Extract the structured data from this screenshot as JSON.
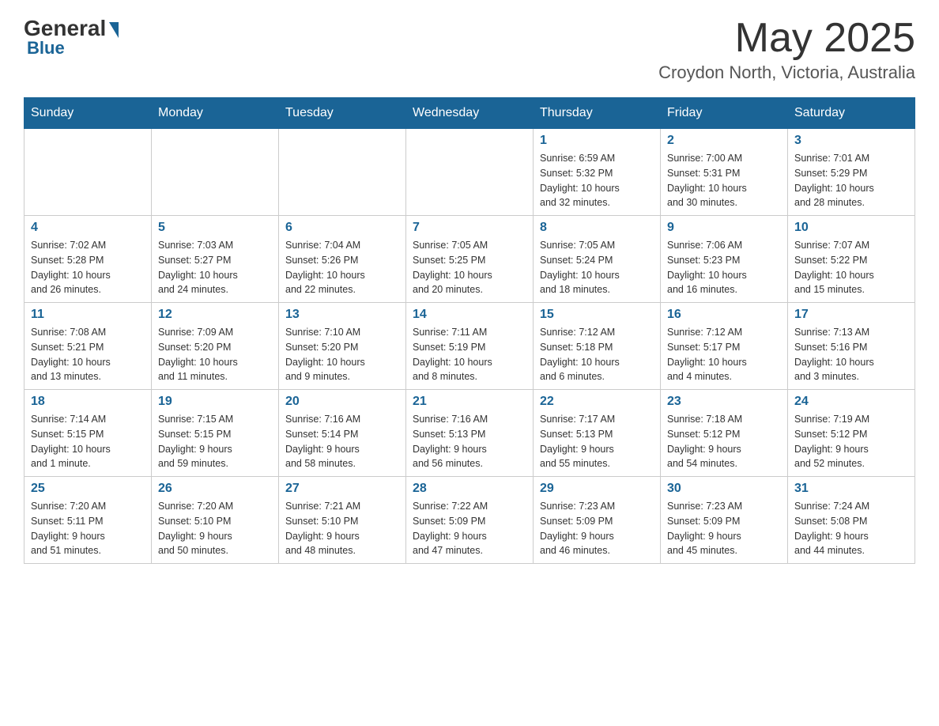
{
  "header": {
    "logo_general": "General",
    "logo_blue": "Blue",
    "month": "May 2025",
    "location": "Croydon North, Victoria, Australia"
  },
  "days_of_week": [
    "Sunday",
    "Monday",
    "Tuesday",
    "Wednesday",
    "Thursday",
    "Friday",
    "Saturday"
  ],
  "weeks": [
    [
      {
        "day": "",
        "info": ""
      },
      {
        "day": "",
        "info": ""
      },
      {
        "day": "",
        "info": ""
      },
      {
        "day": "",
        "info": ""
      },
      {
        "day": "1",
        "info": "Sunrise: 6:59 AM\nSunset: 5:32 PM\nDaylight: 10 hours\nand 32 minutes."
      },
      {
        "day": "2",
        "info": "Sunrise: 7:00 AM\nSunset: 5:31 PM\nDaylight: 10 hours\nand 30 minutes."
      },
      {
        "day": "3",
        "info": "Sunrise: 7:01 AM\nSunset: 5:29 PM\nDaylight: 10 hours\nand 28 minutes."
      }
    ],
    [
      {
        "day": "4",
        "info": "Sunrise: 7:02 AM\nSunset: 5:28 PM\nDaylight: 10 hours\nand 26 minutes."
      },
      {
        "day": "5",
        "info": "Sunrise: 7:03 AM\nSunset: 5:27 PM\nDaylight: 10 hours\nand 24 minutes."
      },
      {
        "day": "6",
        "info": "Sunrise: 7:04 AM\nSunset: 5:26 PM\nDaylight: 10 hours\nand 22 minutes."
      },
      {
        "day": "7",
        "info": "Sunrise: 7:05 AM\nSunset: 5:25 PM\nDaylight: 10 hours\nand 20 minutes."
      },
      {
        "day": "8",
        "info": "Sunrise: 7:05 AM\nSunset: 5:24 PM\nDaylight: 10 hours\nand 18 minutes."
      },
      {
        "day": "9",
        "info": "Sunrise: 7:06 AM\nSunset: 5:23 PM\nDaylight: 10 hours\nand 16 minutes."
      },
      {
        "day": "10",
        "info": "Sunrise: 7:07 AM\nSunset: 5:22 PM\nDaylight: 10 hours\nand 15 minutes."
      }
    ],
    [
      {
        "day": "11",
        "info": "Sunrise: 7:08 AM\nSunset: 5:21 PM\nDaylight: 10 hours\nand 13 minutes."
      },
      {
        "day": "12",
        "info": "Sunrise: 7:09 AM\nSunset: 5:20 PM\nDaylight: 10 hours\nand 11 minutes."
      },
      {
        "day": "13",
        "info": "Sunrise: 7:10 AM\nSunset: 5:20 PM\nDaylight: 10 hours\nand 9 minutes."
      },
      {
        "day": "14",
        "info": "Sunrise: 7:11 AM\nSunset: 5:19 PM\nDaylight: 10 hours\nand 8 minutes."
      },
      {
        "day": "15",
        "info": "Sunrise: 7:12 AM\nSunset: 5:18 PM\nDaylight: 10 hours\nand 6 minutes."
      },
      {
        "day": "16",
        "info": "Sunrise: 7:12 AM\nSunset: 5:17 PM\nDaylight: 10 hours\nand 4 minutes."
      },
      {
        "day": "17",
        "info": "Sunrise: 7:13 AM\nSunset: 5:16 PM\nDaylight: 10 hours\nand 3 minutes."
      }
    ],
    [
      {
        "day": "18",
        "info": "Sunrise: 7:14 AM\nSunset: 5:15 PM\nDaylight: 10 hours\nand 1 minute."
      },
      {
        "day": "19",
        "info": "Sunrise: 7:15 AM\nSunset: 5:15 PM\nDaylight: 9 hours\nand 59 minutes."
      },
      {
        "day": "20",
        "info": "Sunrise: 7:16 AM\nSunset: 5:14 PM\nDaylight: 9 hours\nand 58 minutes."
      },
      {
        "day": "21",
        "info": "Sunrise: 7:16 AM\nSunset: 5:13 PM\nDaylight: 9 hours\nand 56 minutes."
      },
      {
        "day": "22",
        "info": "Sunrise: 7:17 AM\nSunset: 5:13 PM\nDaylight: 9 hours\nand 55 minutes."
      },
      {
        "day": "23",
        "info": "Sunrise: 7:18 AM\nSunset: 5:12 PM\nDaylight: 9 hours\nand 54 minutes."
      },
      {
        "day": "24",
        "info": "Sunrise: 7:19 AM\nSunset: 5:12 PM\nDaylight: 9 hours\nand 52 minutes."
      }
    ],
    [
      {
        "day": "25",
        "info": "Sunrise: 7:20 AM\nSunset: 5:11 PM\nDaylight: 9 hours\nand 51 minutes."
      },
      {
        "day": "26",
        "info": "Sunrise: 7:20 AM\nSunset: 5:10 PM\nDaylight: 9 hours\nand 50 minutes."
      },
      {
        "day": "27",
        "info": "Sunrise: 7:21 AM\nSunset: 5:10 PM\nDaylight: 9 hours\nand 48 minutes."
      },
      {
        "day": "28",
        "info": "Sunrise: 7:22 AM\nSunset: 5:09 PM\nDaylight: 9 hours\nand 47 minutes."
      },
      {
        "day": "29",
        "info": "Sunrise: 7:23 AM\nSunset: 5:09 PM\nDaylight: 9 hours\nand 46 minutes."
      },
      {
        "day": "30",
        "info": "Sunrise: 7:23 AM\nSunset: 5:09 PM\nDaylight: 9 hours\nand 45 minutes."
      },
      {
        "day": "31",
        "info": "Sunrise: 7:24 AM\nSunset: 5:08 PM\nDaylight: 9 hours\nand 44 minutes."
      }
    ]
  ]
}
